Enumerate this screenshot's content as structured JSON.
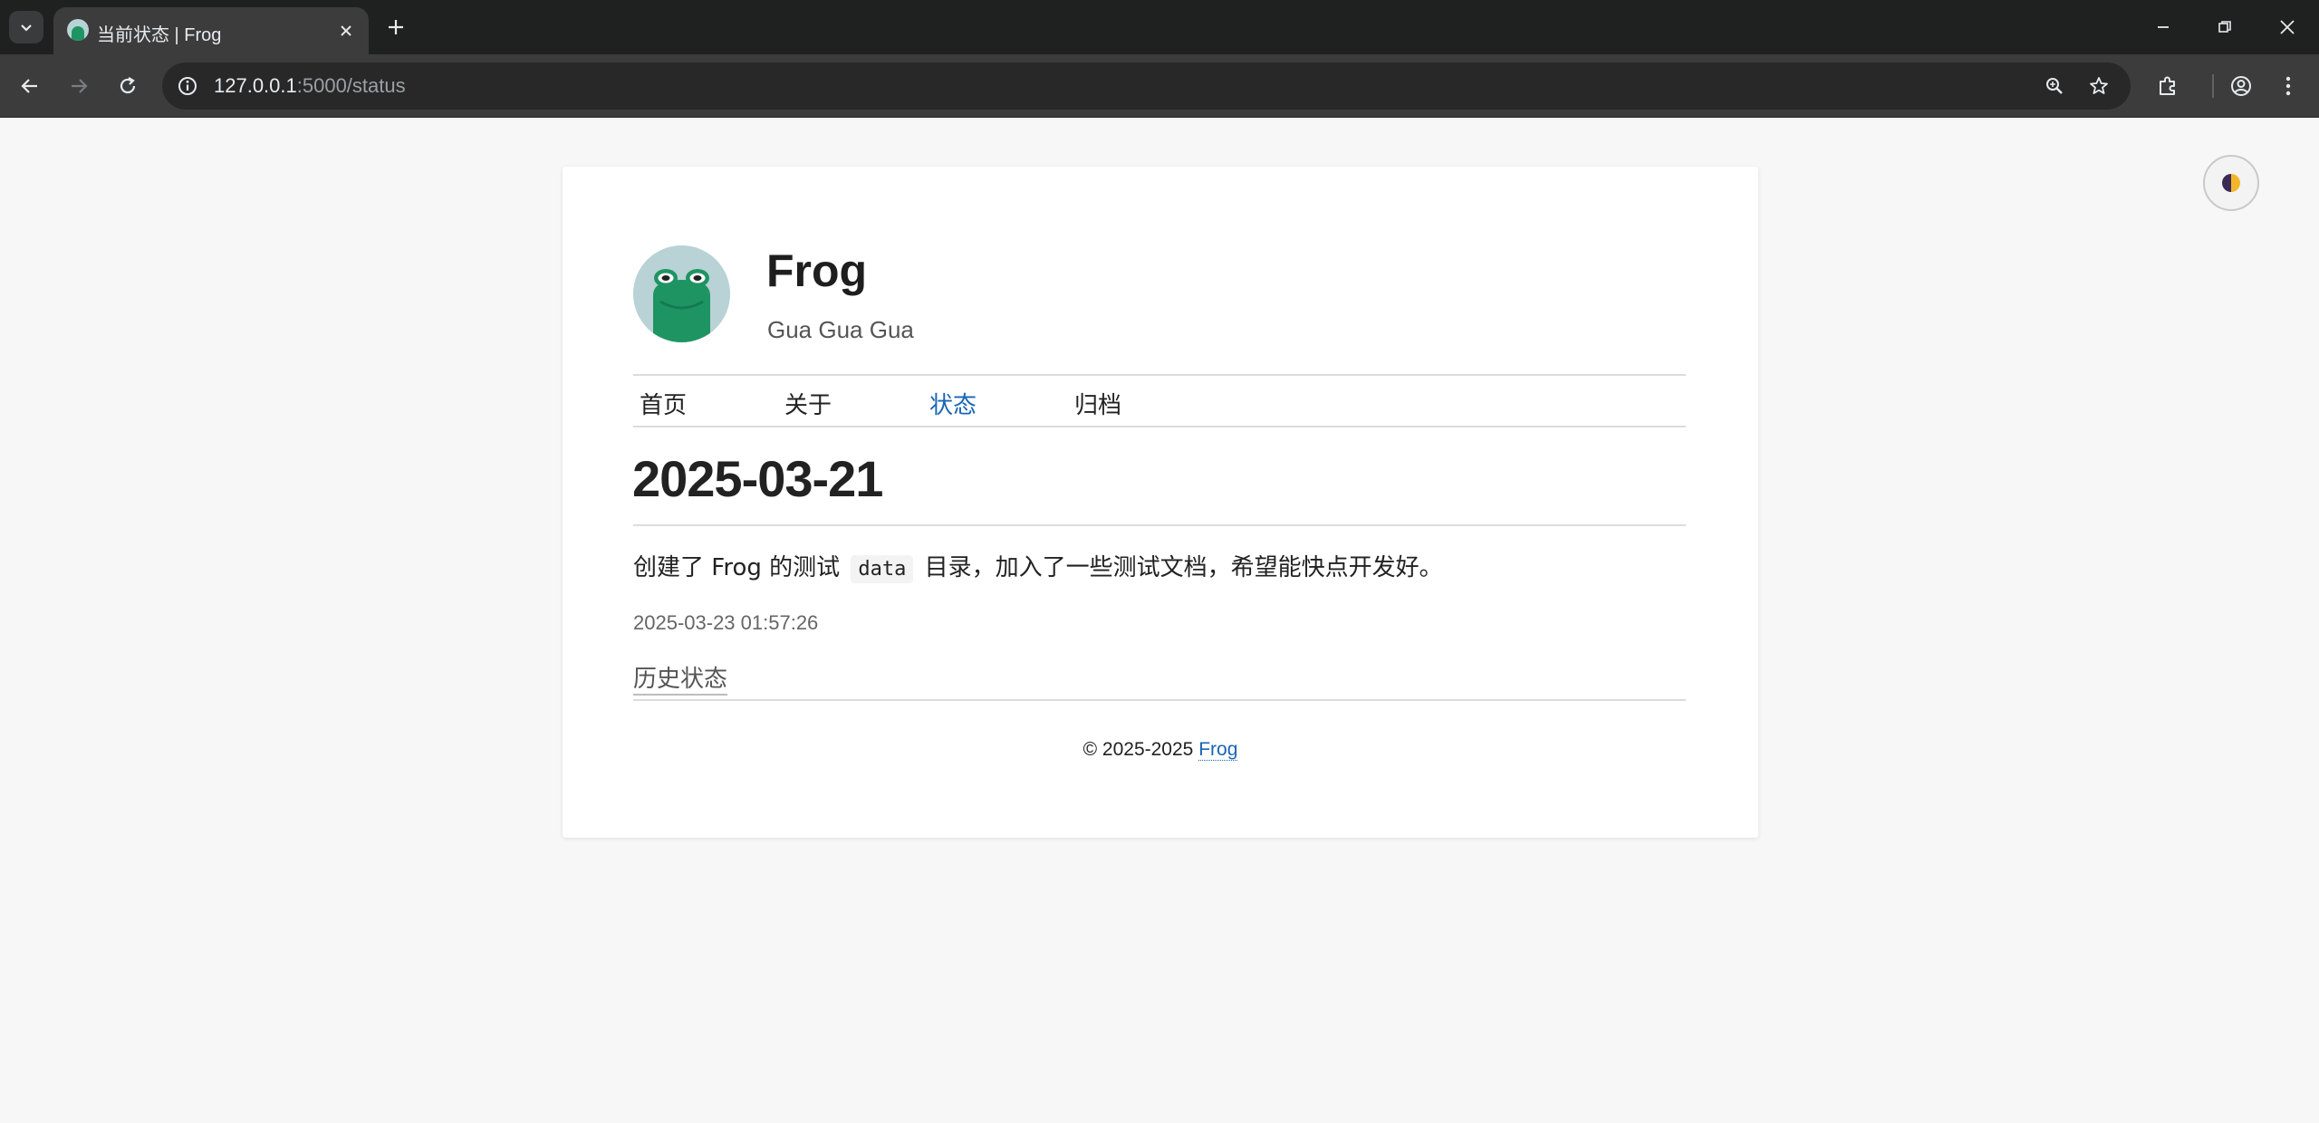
{
  "browser": {
    "tab_title": "当前状态 | Frog",
    "url_host": "127.0.0.1",
    "url_path": ":5000/status"
  },
  "site": {
    "title": "Frog",
    "subtitle": "Gua Gua Gua"
  },
  "nav": {
    "items": [
      {
        "label": "首页",
        "active": false
      },
      {
        "label": "关于",
        "active": false
      },
      {
        "label": "状态",
        "active": true
      },
      {
        "label": "归档",
        "active": false
      }
    ]
  },
  "post": {
    "title": "2025-03-21",
    "text_before": "创建了 Frog 的测试",
    "code": "data",
    "text_after": "目录，加入了一些测试文档，希望能快点开发好。",
    "timestamp": "2025-03-23 01:57:26",
    "history_link": "历史状态"
  },
  "footer": {
    "copyright": "© 2025-2025",
    "link": "Frog"
  },
  "colors": {
    "accent": "#1a65b5",
    "frog_green": "#1f9463",
    "avatar_bg": "#b9d2d5"
  }
}
